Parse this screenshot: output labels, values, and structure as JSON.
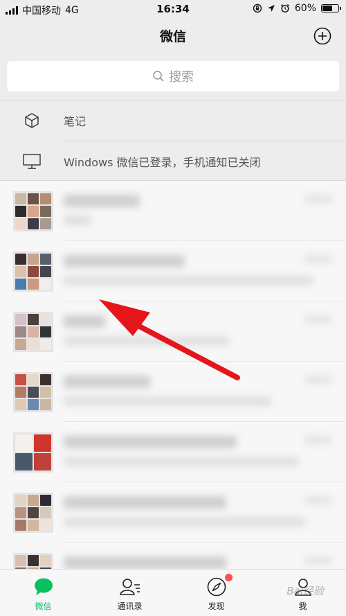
{
  "status_bar": {
    "carrier": "中国移动",
    "network": "4G",
    "time": "16:34",
    "battery": "60%",
    "icons": [
      "lock-rotation-icon",
      "location-icon",
      "alarm-icon",
      "battery-icon"
    ]
  },
  "nav": {
    "title": "微信",
    "add_icon": "plus-circle-icon"
  },
  "search": {
    "placeholder": "搜索",
    "icon": "search-icon"
  },
  "system_rows": [
    {
      "icon": "cube-icon",
      "label": "笔记"
    },
    {
      "icon": "monitor-icon",
      "label": "Windows 微信已登录，手机通知已关闭"
    }
  ],
  "chats": [
    {
      "kind": "group",
      "content": "blurred"
    },
    {
      "kind": "group",
      "content": "blurred"
    },
    {
      "kind": "group",
      "content": "blurred"
    },
    {
      "kind": "group",
      "content": "blurred"
    },
    {
      "kind": "group",
      "content": "blurred"
    },
    {
      "kind": "group",
      "content": "blurred"
    },
    {
      "kind": "group",
      "content": "blurred"
    }
  ],
  "annotation": {
    "type": "arrow",
    "color": "#e5161b"
  },
  "tabs": [
    {
      "label": "微信",
      "icon": "chat-bubble-icon",
      "active": true
    },
    {
      "label": "通讯录",
      "icon": "contacts-icon",
      "active": false
    },
    {
      "label": "发现",
      "icon": "compass-icon",
      "active": false,
      "badge": "red-dot"
    },
    {
      "label": "我",
      "icon": "person-icon",
      "active": false
    }
  ],
  "watermark": "Bai经验",
  "colors": {
    "accent": "#07c160",
    "badge": "#fa5151",
    "arrow": "#e5161b",
    "background": "#ededed"
  }
}
